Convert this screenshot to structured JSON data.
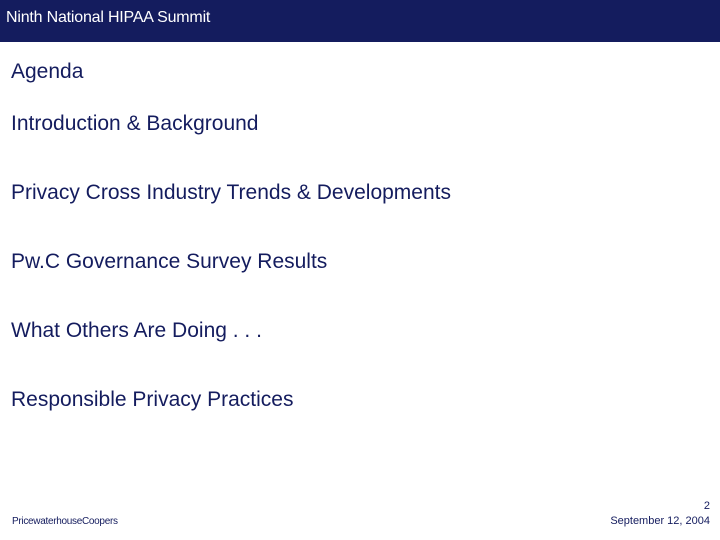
{
  "header": {
    "title": "Ninth National HIPAA Summit"
  },
  "slide": {
    "title": "Agenda",
    "items": [
      "Introduction & Background",
      "Privacy Cross Industry Trends & Developments",
      "Pw.C Governance Survey Results",
      "What Others Are Doing . . .",
      "Responsible Privacy Practices"
    ]
  },
  "footer": {
    "company": "PricewaterhouseCoopers",
    "page_number": "2",
    "date": "September 12, 2004"
  },
  "colors": {
    "header_bg": "#141c5e",
    "text": "#141c5e",
    "background": "#ffffff"
  }
}
